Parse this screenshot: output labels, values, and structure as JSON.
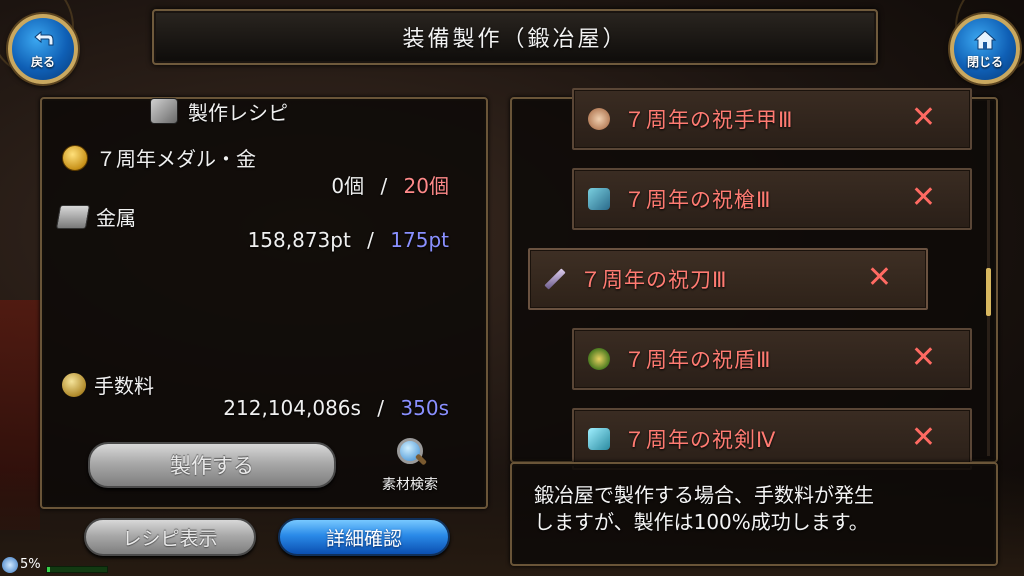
{
  "title": "装備製作（鍛冶屋）",
  "back_button": {
    "label": "戻る",
    "icon": "back-arrow-icon"
  },
  "close_button": {
    "label": "閉じる",
    "icon": "home-icon"
  },
  "recipe_panel": {
    "header": "製作レシピ",
    "materials": [
      {
        "name": "７周年メダル・金",
        "icon": "gold-medal-icon",
        "owned": "0個",
        "separator": "/",
        "required": "20個",
        "required_color": "#ff8a8a"
      },
      {
        "name": "金属",
        "icon": "metal-icon",
        "owned": "158,873pt",
        "separator": "/",
        "required": "175pt",
        "required_color": "#8a90ff"
      }
    ],
    "fee": {
      "name": "手数料",
      "icon": "coins-icon",
      "owned": "212,104,086s",
      "separator": "/",
      "required": "350s",
      "required_color": "#8a90ff"
    },
    "craft_button": "製作する",
    "material_search": "素材検索"
  },
  "bottom_buttons": {
    "recipe_display": "レシピ表示",
    "detail_confirm": "詳細確認"
  },
  "recipe_list": [
    {
      "name": "７周年の祝手甲Ⅲ",
      "icon": "gauntlet-icon",
      "mark": "✕",
      "selected": false
    },
    {
      "name": "７周年の祝槍Ⅲ",
      "icon": "spear-icon",
      "mark": "✕",
      "selected": false
    },
    {
      "name": "７周年の祝刀Ⅲ",
      "icon": "katana-icon",
      "mark": "✕",
      "selected": true
    },
    {
      "name": "７周年の祝盾Ⅲ",
      "icon": "shield-icon",
      "mark": "✕",
      "selected": false
    },
    {
      "name": "７周年の祝剣Ⅳ",
      "icon": "sword-icon",
      "mark": "✕",
      "selected": false
    }
  ],
  "description": {
    "line1": "鍛冶屋で製作する場合、手数料が発生",
    "line2": "しますが、製作は100%成功します。"
  },
  "status": {
    "progress_text": "5%",
    "progress_value": 0.05
  },
  "colors": {
    "item_name": "#ff7b72",
    "accent_gold": "#c9a860",
    "button_blue": "#2a8ae8"
  }
}
